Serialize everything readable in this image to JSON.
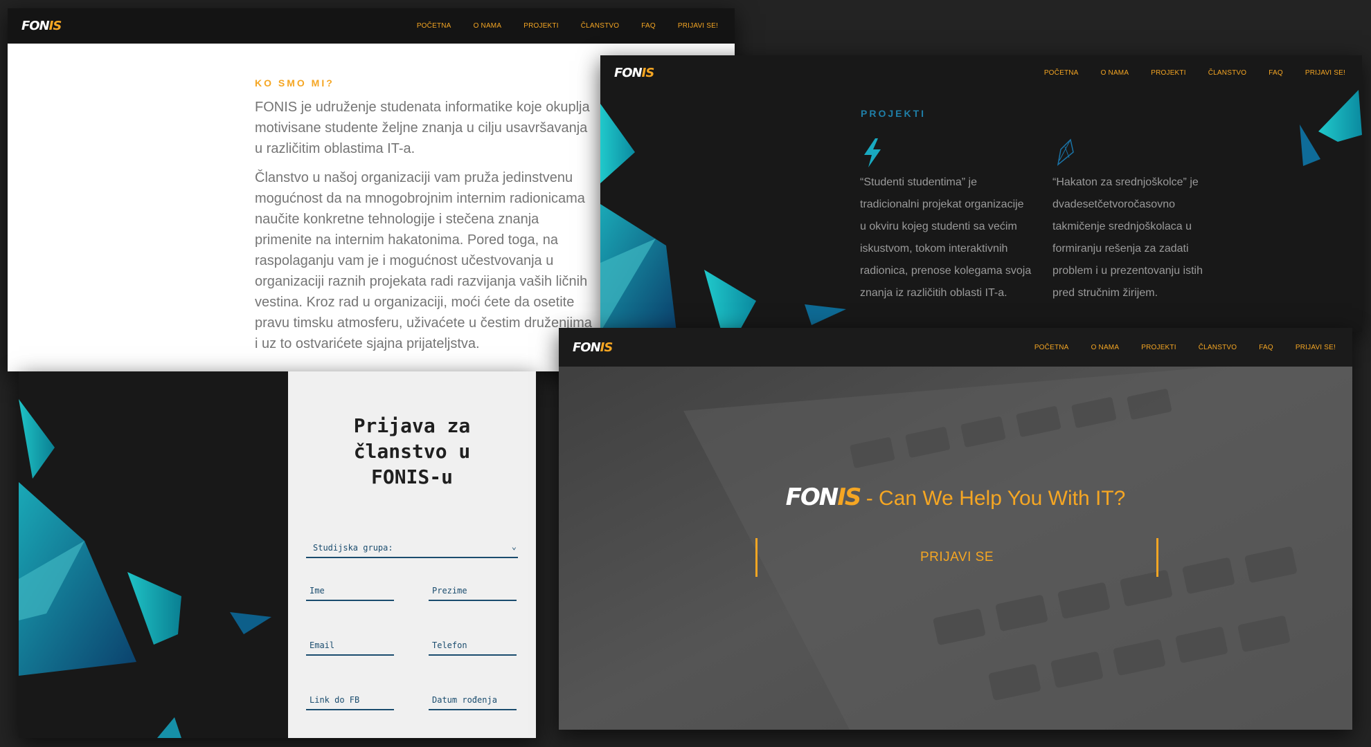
{
  "brand": {
    "logo_main": "FON",
    "logo_accent": "IS"
  },
  "nav": {
    "items": [
      "POČETNA",
      "O NAMA",
      "PROJEKTI",
      "ČLANSTVO",
      "FAQ",
      "PRIJAVI SE!"
    ]
  },
  "about": {
    "kicker": "KO SMO MI?",
    "lines": [
      "FONIS je udruženje studenata informatike koje okuplja",
      "motivisane studente željne znanja u cilju usavršavanja",
      "u različitim oblastima IT-a.",
      "Članstvo u našoj organizaciji vam pruža jedinstvenu",
      "mogućnost da na mnogobrojnim internim radionicama",
      "naučite konkretne tehnologije i stečena znanja",
      "primenite na internim hakatonima. Pored toga, na",
      "raspolaganju vam je i mogućnost učestvovanja u",
      "organizaciji raznih projekata radi razvijanja vaših ličnih",
      "vestina. Kroz rad u organizaciji, moći ćete da osetite",
      "pravu timsku atmosferu, uživaćete u čestim druženjima",
      "i uz to ostvarićete sjajna prijateljstva."
    ]
  },
  "membership_form": {
    "title": "Prijava za članstvo u FONIS-u",
    "title_lines": [
      "Prijava za",
      "članstvo u",
      "FONIS-u"
    ],
    "group_select": "Studijska grupa:",
    "fields": {
      "first_name": "Ime",
      "last_name": "Prezime",
      "email": "Email",
      "phone": "Telefon",
      "fb_link": "Link do FB",
      "birth_date": "Datum rođenja"
    }
  },
  "projects": {
    "kicker": "PROJEKTI",
    "items": [
      {
        "icon": "lightning-icon",
        "lines": [
          "“Studenti studentima” je",
          "tradicionalni projekat organizacije",
          "u okviru kojeg studenti sa većim",
          "iskustvom, tokom interaktivnih",
          "radionica, prenose kolegama svoja",
          "znanja iz različitih oblasti IT-a."
        ]
      },
      {
        "icon": "rocket-icon",
        "lines": [
          "“Hakaton za srednjoškolce” je",
          "dvadesetčetvoročasovno",
          "takmičenje srednjoškolaca u",
          "formiranju rešenja za zadati",
          "problem i u prezentovanju istih",
          "pred stručnim žirijem."
        ]
      }
    ]
  },
  "hero": {
    "tagline": "- Can We Help You With IT?",
    "cta": "PRIJAVI SE"
  },
  "colors": {
    "accent": "#f5a623",
    "teal": "#13b3b8",
    "blue": "#1a4c6e"
  }
}
